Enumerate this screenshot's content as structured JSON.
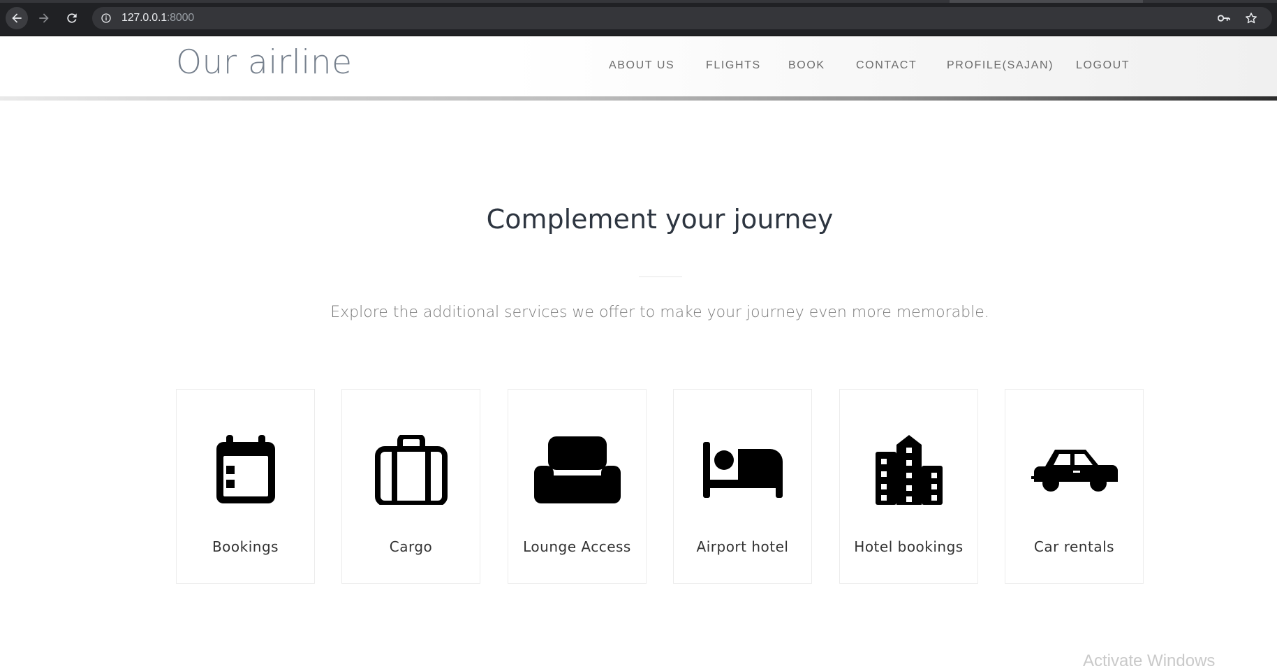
{
  "browser": {
    "url_host": "127.0.0.1",
    "url_port": ":8000",
    "accent": "#202124"
  },
  "header": {
    "brand": "Our airline",
    "nav": [
      {
        "label": "ABOUT US"
      },
      {
        "label": "FLIGHTS"
      },
      {
        "label": "BOOK"
      },
      {
        "label": "CONTACT"
      },
      {
        "label": "PROFILE(SAJAN)"
      },
      {
        "label": "LOGOUT"
      }
    ]
  },
  "main": {
    "title": "Complement your journey",
    "subtitle": "Explore the additional services we offer to make your journey even more memorable.",
    "services": [
      {
        "label": "Bookings",
        "icon": "calendar-icon"
      },
      {
        "label": "Cargo",
        "icon": "suitcase-icon"
      },
      {
        "label": "Lounge Access",
        "icon": "couch-icon"
      },
      {
        "label": "Airport hotel",
        "icon": "bed-icon"
      },
      {
        "label": "Hotel bookings",
        "icon": "building-icon"
      },
      {
        "label": "Car rentals",
        "icon": "car-icon"
      }
    ]
  },
  "watermark": "Activate Windows"
}
